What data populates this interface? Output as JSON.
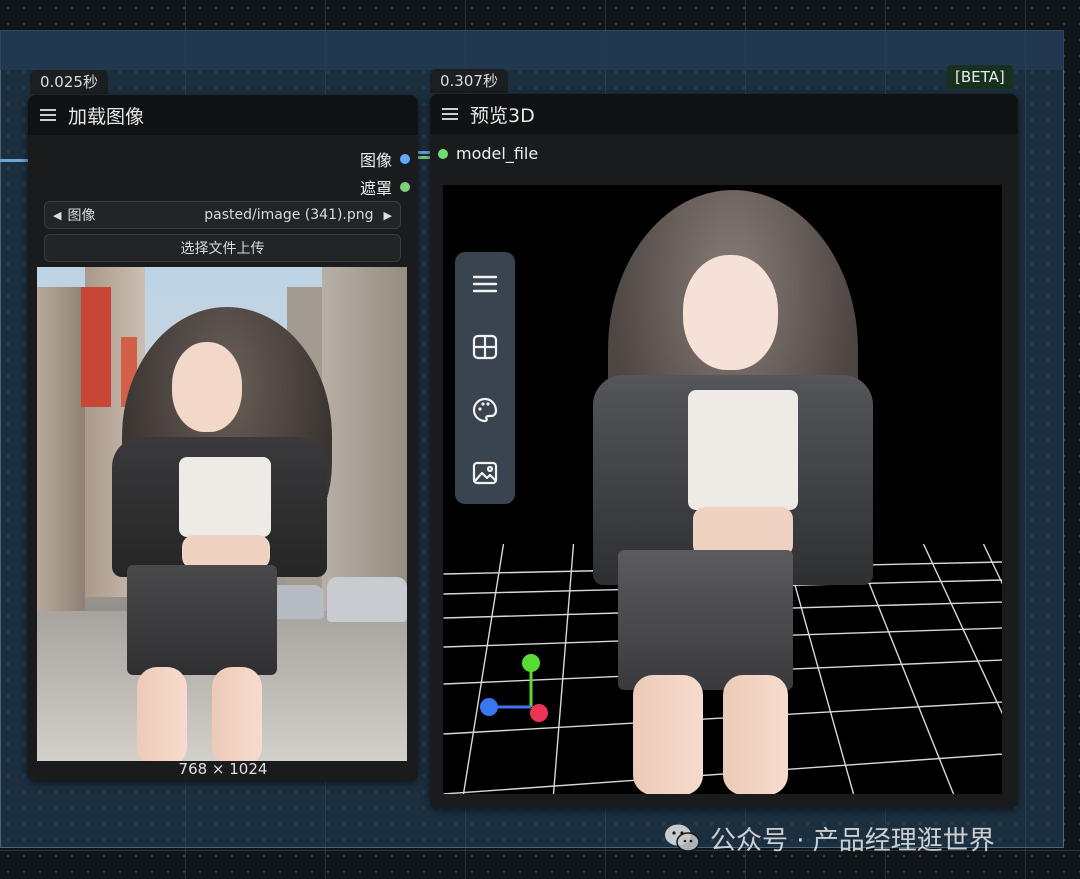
{
  "load_node": {
    "time": "0.025秒",
    "title": "加载图像",
    "outputs": [
      {
        "label": "图像",
        "color": "#64a8ff"
      },
      {
        "label": "遮罩",
        "color": "#7ed07e"
      }
    ],
    "image_widget": {
      "label": "图像",
      "value": "pasted/image (341).png"
    },
    "upload_button": "选择文件上传",
    "dimensions": "768 × 1024"
  },
  "preview_node": {
    "time": "0.307秒",
    "title": "预览3D",
    "badge": "[BETA]",
    "input": {
      "label": "model_file",
      "color": "#6fe06f"
    },
    "toolbar": [
      "menu-icon",
      "layout-grid-icon",
      "palette-icon",
      "image-icon"
    ],
    "axis_colors": {
      "x": "#ee3355",
      "y": "#55dd33",
      "z": "#3a77ee"
    }
  },
  "watermark": {
    "channel": "公众号 · 产品经理逛世界"
  },
  "colors": {
    "group_fill": "#213a52",
    "node_bg": "#1a1b1d",
    "toolbar_bg": "#3a4350"
  }
}
